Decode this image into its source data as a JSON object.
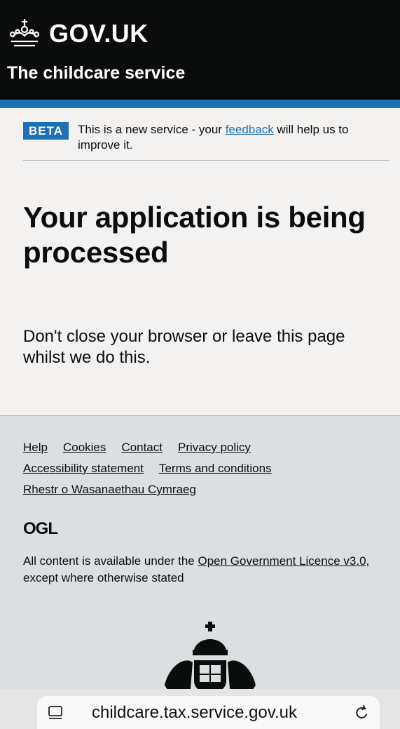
{
  "header": {
    "brand": "GOV.UK",
    "service_name": "The childcare service"
  },
  "phase_banner": {
    "tag": "BETA",
    "text_before": "This is a new service - your ",
    "link": "feedback",
    "text_after": " will help us to improve it."
  },
  "main": {
    "heading": "Your application is being processed",
    "body": "Don't close your browser or leave this page whilst we do this."
  },
  "footer": {
    "links": [
      "Help",
      "Cookies",
      "Contact",
      "Privacy policy",
      "Accessibility statement",
      "Terms and conditions",
      "Rhestr o Wasanaethau Cymraeg"
    ],
    "ogl_logo": "OGL",
    "licence_before": "All content is available under the ",
    "licence_link": "Open Government Licence v3.0",
    "licence_after": ", except where otherwise stated"
  },
  "browser": {
    "url": "childcare.tax.service.gov.uk"
  },
  "colors": {
    "header_bg": "#0b0c0c",
    "accent_blue": "#1d70b8",
    "footer_bg": "#dcdfe1"
  }
}
